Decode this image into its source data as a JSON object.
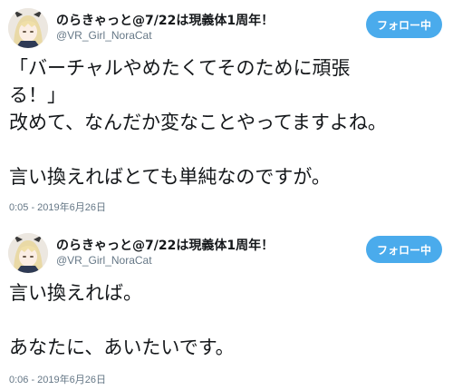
{
  "tweets": [
    {
      "display_name": "のらきゃっと@7/22は現義体1周年！",
      "handle": "@VR_Girl_NoraCat",
      "follow_label": "フォロー中",
      "lines": [
        "「バーチャルやめたくてそのために頑張",
        "る！」",
        "改めて、なんだか変なことやってますよね。",
        "",
        "言い換えればとても単純なのですが。"
      ],
      "timestamp": "0:05 - 2019年6月26日"
    },
    {
      "display_name": "のらきゃっと@7/22は現義体1周年！",
      "handle": "@VR_Girl_NoraCat",
      "follow_label": "フォロー中",
      "lines": [
        "言い換えれば。",
        "",
        "あなたに、あいたいです。"
      ],
      "timestamp": "0:06 - 2019年6月26日"
    }
  ]
}
